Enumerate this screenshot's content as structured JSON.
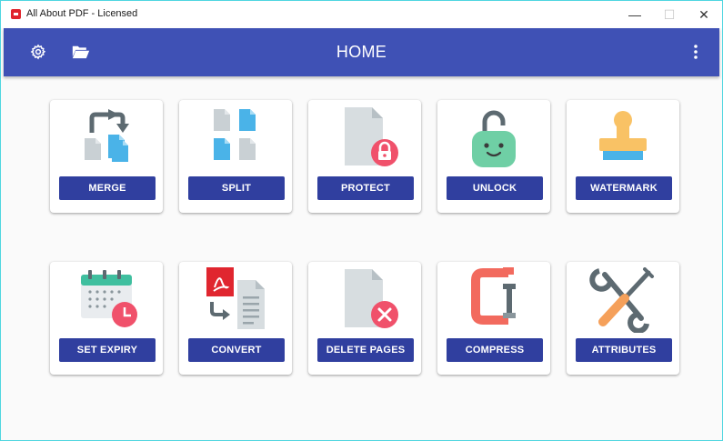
{
  "window": {
    "title": "All About PDF - Licensed",
    "controls": {
      "minimize": "—",
      "maximize": "☐",
      "close": "✕"
    }
  },
  "appbar": {
    "title": "HOME",
    "left_icons": [
      "gear-icon",
      "folder-open-icon"
    ],
    "right_icon": "more-vert-icon",
    "color": "#3f51b5"
  },
  "tools": [
    {
      "label": "MERGE",
      "icon": "merge-icon"
    },
    {
      "label": "SPLIT",
      "icon": "split-icon"
    },
    {
      "label": "PROTECT",
      "icon": "protect-icon"
    },
    {
      "label": "UNLOCK",
      "icon": "unlock-icon"
    },
    {
      "label": "WATERMARK",
      "icon": "watermark-icon"
    },
    {
      "label": "SET EXPIRY",
      "icon": "calendar-clock-icon"
    },
    {
      "label": "CONVERT",
      "icon": "convert-icon"
    },
    {
      "label": "DELETE PAGES",
      "icon": "delete-pages-icon"
    },
    {
      "label": "COMPRESS",
      "icon": "clamp-icon"
    },
    {
      "label": "ATTRIBUTES",
      "icon": "tools-icon"
    }
  ],
  "colors": {
    "button": "#303f9f",
    "accent_red": "#f0516b",
    "doc_gray": "#d7dde0",
    "doc_blue": "#4ab3e8"
  }
}
